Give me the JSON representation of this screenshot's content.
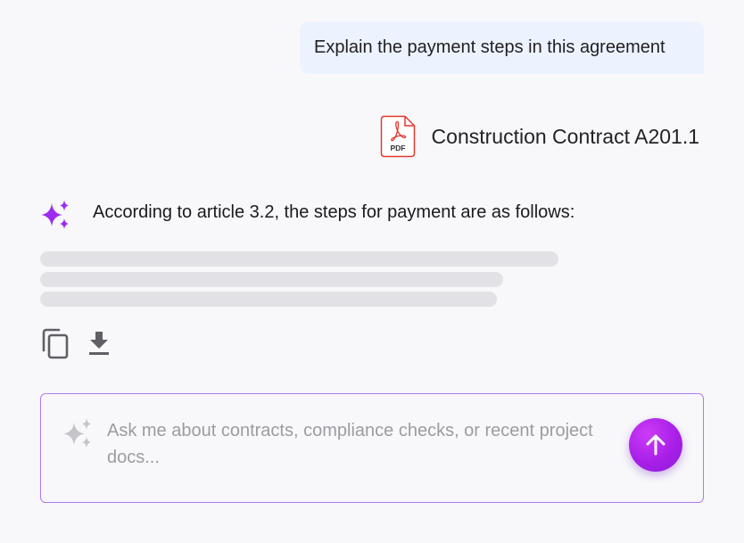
{
  "user_message": {
    "text": "Explain the payment steps in this agreement"
  },
  "attachment": {
    "file_type": "PDF",
    "name": "Construction Contract A201.1",
    "icon": "pdf-file-icon"
  },
  "assistant": {
    "avatar_icon": "sparkle-icon",
    "response_text": "According to article 3.2, the steps for payment are as follows:",
    "actions": {
      "copy_icon": "copy-icon",
      "download_icon": "download-icon"
    }
  },
  "composer": {
    "placeholder": "Ask me about contracts, compliance checks, or recent project docs...",
    "value": "",
    "send_icon": "arrow-up-icon"
  },
  "colors": {
    "accent": "#a81fe8",
    "sparkle": "#9b2cf0",
    "user_bubble": "#edf3fe",
    "pdf_red": "#e2382c",
    "input_border": "#b27af0",
    "skeleton": "#e2e1e5"
  }
}
